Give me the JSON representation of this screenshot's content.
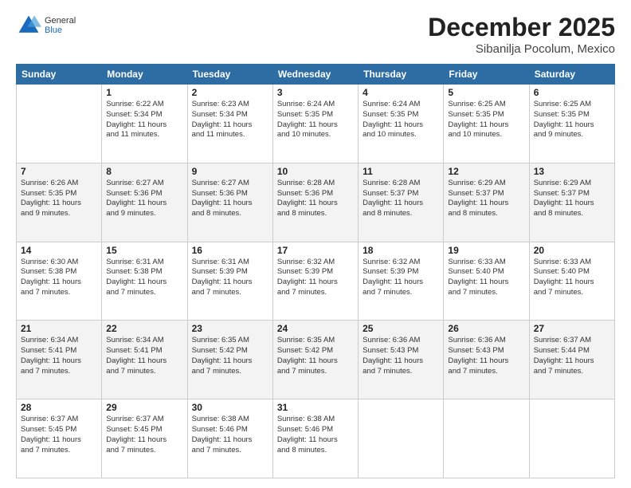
{
  "header": {
    "logo_general": "General",
    "logo_blue": "Blue",
    "month_title": "December 2025",
    "location": "Sibanilja Pocolum, Mexico"
  },
  "days_of_week": [
    "Sunday",
    "Monday",
    "Tuesday",
    "Wednesday",
    "Thursday",
    "Friday",
    "Saturday"
  ],
  "weeks": [
    [
      {
        "day": "",
        "info": ""
      },
      {
        "day": "1",
        "info": "Sunrise: 6:22 AM\nSunset: 5:34 PM\nDaylight: 11 hours\nand 11 minutes."
      },
      {
        "day": "2",
        "info": "Sunrise: 6:23 AM\nSunset: 5:34 PM\nDaylight: 11 hours\nand 11 minutes."
      },
      {
        "day": "3",
        "info": "Sunrise: 6:24 AM\nSunset: 5:35 PM\nDaylight: 11 hours\nand 10 minutes."
      },
      {
        "day": "4",
        "info": "Sunrise: 6:24 AM\nSunset: 5:35 PM\nDaylight: 11 hours\nand 10 minutes."
      },
      {
        "day": "5",
        "info": "Sunrise: 6:25 AM\nSunset: 5:35 PM\nDaylight: 11 hours\nand 10 minutes."
      },
      {
        "day": "6",
        "info": "Sunrise: 6:25 AM\nSunset: 5:35 PM\nDaylight: 11 hours\nand 9 minutes."
      }
    ],
    [
      {
        "day": "7",
        "info": "Sunrise: 6:26 AM\nSunset: 5:35 PM\nDaylight: 11 hours\nand 9 minutes."
      },
      {
        "day": "8",
        "info": "Sunrise: 6:27 AM\nSunset: 5:36 PM\nDaylight: 11 hours\nand 9 minutes."
      },
      {
        "day": "9",
        "info": "Sunrise: 6:27 AM\nSunset: 5:36 PM\nDaylight: 11 hours\nand 8 minutes."
      },
      {
        "day": "10",
        "info": "Sunrise: 6:28 AM\nSunset: 5:36 PM\nDaylight: 11 hours\nand 8 minutes."
      },
      {
        "day": "11",
        "info": "Sunrise: 6:28 AM\nSunset: 5:37 PM\nDaylight: 11 hours\nand 8 minutes."
      },
      {
        "day": "12",
        "info": "Sunrise: 6:29 AM\nSunset: 5:37 PM\nDaylight: 11 hours\nand 8 minutes."
      },
      {
        "day": "13",
        "info": "Sunrise: 6:29 AM\nSunset: 5:37 PM\nDaylight: 11 hours\nand 8 minutes."
      }
    ],
    [
      {
        "day": "14",
        "info": "Sunrise: 6:30 AM\nSunset: 5:38 PM\nDaylight: 11 hours\nand 7 minutes."
      },
      {
        "day": "15",
        "info": "Sunrise: 6:31 AM\nSunset: 5:38 PM\nDaylight: 11 hours\nand 7 minutes."
      },
      {
        "day": "16",
        "info": "Sunrise: 6:31 AM\nSunset: 5:39 PM\nDaylight: 11 hours\nand 7 minutes."
      },
      {
        "day": "17",
        "info": "Sunrise: 6:32 AM\nSunset: 5:39 PM\nDaylight: 11 hours\nand 7 minutes."
      },
      {
        "day": "18",
        "info": "Sunrise: 6:32 AM\nSunset: 5:39 PM\nDaylight: 11 hours\nand 7 minutes."
      },
      {
        "day": "19",
        "info": "Sunrise: 6:33 AM\nSunset: 5:40 PM\nDaylight: 11 hours\nand 7 minutes."
      },
      {
        "day": "20",
        "info": "Sunrise: 6:33 AM\nSunset: 5:40 PM\nDaylight: 11 hours\nand 7 minutes."
      }
    ],
    [
      {
        "day": "21",
        "info": "Sunrise: 6:34 AM\nSunset: 5:41 PM\nDaylight: 11 hours\nand 7 minutes."
      },
      {
        "day": "22",
        "info": "Sunrise: 6:34 AM\nSunset: 5:41 PM\nDaylight: 11 hours\nand 7 minutes."
      },
      {
        "day": "23",
        "info": "Sunrise: 6:35 AM\nSunset: 5:42 PM\nDaylight: 11 hours\nand 7 minutes."
      },
      {
        "day": "24",
        "info": "Sunrise: 6:35 AM\nSunset: 5:42 PM\nDaylight: 11 hours\nand 7 minutes."
      },
      {
        "day": "25",
        "info": "Sunrise: 6:36 AM\nSunset: 5:43 PM\nDaylight: 11 hours\nand 7 minutes."
      },
      {
        "day": "26",
        "info": "Sunrise: 6:36 AM\nSunset: 5:43 PM\nDaylight: 11 hours\nand 7 minutes."
      },
      {
        "day": "27",
        "info": "Sunrise: 6:37 AM\nSunset: 5:44 PM\nDaylight: 11 hours\nand 7 minutes."
      }
    ],
    [
      {
        "day": "28",
        "info": "Sunrise: 6:37 AM\nSunset: 5:45 PM\nDaylight: 11 hours\nand 7 minutes."
      },
      {
        "day": "29",
        "info": "Sunrise: 6:37 AM\nSunset: 5:45 PM\nDaylight: 11 hours\nand 7 minutes."
      },
      {
        "day": "30",
        "info": "Sunrise: 6:38 AM\nSunset: 5:46 PM\nDaylight: 11 hours\nand 7 minutes."
      },
      {
        "day": "31",
        "info": "Sunrise: 6:38 AM\nSunset: 5:46 PM\nDaylight: 11 hours\nand 8 minutes."
      },
      {
        "day": "",
        "info": ""
      },
      {
        "day": "",
        "info": ""
      },
      {
        "day": "",
        "info": ""
      }
    ]
  ]
}
